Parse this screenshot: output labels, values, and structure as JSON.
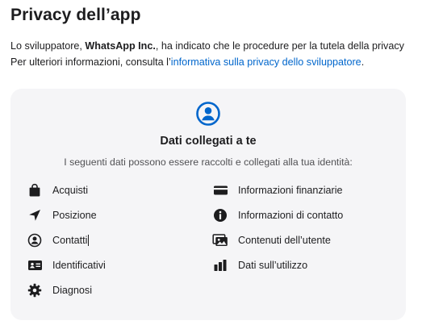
{
  "header": {
    "title": "Privacy dell’app"
  },
  "description": {
    "line1_prefix": "Lo sviluppatore, ",
    "developer": "WhatsApp Inc.",
    "line1_suffix": ", ha indicato che le procedure per la tutela della privacy",
    "line2_prefix": "Per ulteriori informazioni, consulta l’",
    "link_text": "informativa sulla privacy dello sviluppatore",
    "line2_suffix": "."
  },
  "card": {
    "icon": "person-circle-icon",
    "title": "Dati collegati a te",
    "subtitle": "I seguenti dati possono essere raccolti e collegati alla tua identità:",
    "left_items": [
      {
        "label": "Acquisti",
        "icon": "shopping-bag-icon"
      },
      {
        "label": "Posizione",
        "icon": "location-arrow-icon"
      },
      {
        "label": "Contatti",
        "icon": "person-circle-icon"
      },
      {
        "label": "Identificativi",
        "icon": "id-card-icon"
      },
      {
        "label": "Diagnosi",
        "icon": "gear-icon"
      }
    ],
    "right_items": [
      {
        "label": "Informazioni finanziarie",
        "icon": "credit-card-icon"
      },
      {
        "label": "Informazioni di contatto",
        "icon": "info-circle-icon"
      },
      {
        "label": "Contenuti dell’utente",
        "icon": "photos-icon"
      },
      {
        "label": "Dati sull’utilizzo",
        "icon": "bar-chart-icon"
      }
    ]
  },
  "colors": {
    "accent": "#0066cc",
    "card_background": "#f5f5f7",
    "text": "#1d1d1f"
  }
}
